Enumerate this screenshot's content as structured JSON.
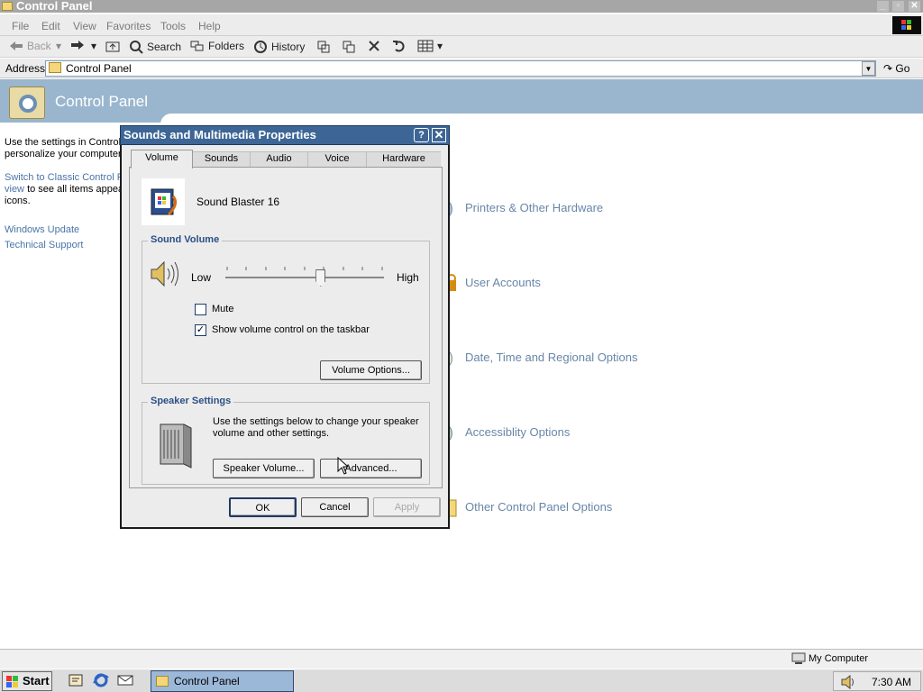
{
  "window": {
    "title": "Control Panel"
  },
  "menu": [
    "File",
    "Edit",
    "View",
    "Favorites",
    "Tools",
    "Help"
  ],
  "toolbar": {
    "back": "Back",
    "search": "Search",
    "folders": "Folders",
    "history": "History"
  },
  "address": {
    "label": "Address",
    "value": "Control Panel",
    "go": "Go"
  },
  "header": {
    "title": "Control Panel"
  },
  "left_pane": {
    "intro": "Use the settings in Control Panel to personalize your computer.",
    "intro_shown_1": "Use the settings in Control",
    "intro_shown_2": "personalize your computer",
    "switch_link_1": "Switch to Classic Control P",
    "switch_link_2": "view",
    "switch_rest_1": " to see all items appea",
    "switch_rest_2": "icons.",
    "links": [
      "Windows Update",
      "Technical Support"
    ]
  },
  "categories": [
    "Printers & Other Hardware",
    "User Accounts",
    "Date, Time and Regional Options",
    "Accessiblity Options",
    "Other Control Panel Options"
  ],
  "dialog": {
    "title": "Sounds and Multimedia Properties",
    "help": "?",
    "close": "✕",
    "tabs": [
      "Volume",
      "Sounds",
      "Audio",
      "Voice",
      "Hardware"
    ],
    "active_tab": "Volume",
    "device": "Sound Blaster 16",
    "sound_volume": {
      "label": "Sound Volume",
      "low": "Low",
      "high": "High",
      "level": 0.6,
      "mute": "Mute",
      "mute_checked": false,
      "show_taskbar": "Show volume control on the taskbar",
      "show_taskbar_checked": true,
      "options_button": "Volume Options..."
    },
    "speaker": {
      "label": "Speaker Settings",
      "text": "Use the settings below to change your speaker volume and other settings.",
      "volume_button": "Speaker Volume...",
      "advanced_button": "Advanced..."
    },
    "buttons": {
      "ok": "OK",
      "cancel": "Cancel",
      "apply": "Apply"
    }
  },
  "status": {
    "zone": "My Computer"
  },
  "taskbar": {
    "start": "Start",
    "task": "Control Panel",
    "clock": "7:30 AM"
  }
}
